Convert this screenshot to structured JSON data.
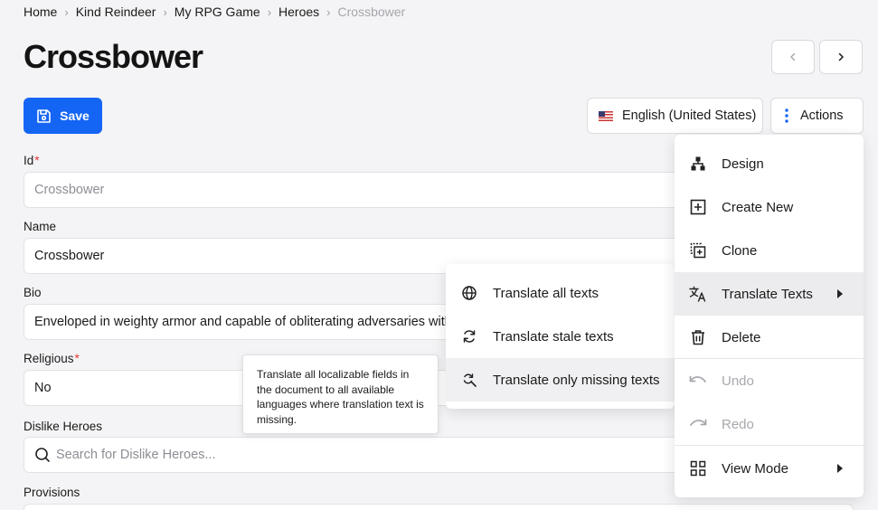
{
  "breadcrumb": [
    "Home",
    "Kind Reindeer",
    "My RPG Game",
    "Heroes",
    "Crossbower"
  ],
  "page_title": "Crossbower",
  "toolbar": {
    "save_label": "Save",
    "language_label": "English (United States)",
    "actions_label": "Actions"
  },
  "fields": {
    "id": {
      "label": "Id",
      "required": "*",
      "placeholder": "Crossbower"
    },
    "name": {
      "label": "Name",
      "value": "Crossbower"
    },
    "bio": {
      "label": "Bio",
      "value": "Enveloped in weighty armor and capable of obliterating adversaries with h"
    },
    "religious": {
      "label": "Religious",
      "required": "*",
      "value": "No"
    },
    "dislike_heroes": {
      "label": "Dislike Heroes",
      "placeholder": "Search for Dislike Heroes..."
    },
    "provisions": {
      "label": "Provisions"
    }
  },
  "actions_menu": {
    "items": [
      {
        "label": "Design",
        "icon": "hierarchy-icon"
      },
      {
        "label": "Create New",
        "icon": "plus-square-icon"
      },
      {
        "label": "Clone",
        "icon": "clone-icon"
      },
      {
        "label": "Translate Texts",
        "icon": "translate-icon"
      },
      {
        "label": "Delete",
        "icon": "trash-icon"
      },
      {
        "label": "Undo",
        "icon": "undo-icon",
        "disabled": true
      },
      {
        "label": "Redo",
        "icon": "redo-icon",
        "disabled": true
      },
      {
        "label": "View Mode",
        "icon": "grid-icon"
      }
    ]
  },
  "translate_submenu": {
    "items": [
      {
        "label": "Translate all texts",
        "icon": "globe-icon"
      },
      {
        "label": "Translate stale texts",
        "icon": "refresh-icon"
      },
      {
        "label": "Translate only missing texts",
        "icon": "search-refresh-icon"
      }
    ]
  },
  "tooltip": {
    "text": "Translate all localizable fields in the document to all available languages where translation text is missing."
  },
  "colors": {
    "primary": "#1565f5",
    "required": "#e53935",
    "disabled": "#a8a8ae"
  }
}
